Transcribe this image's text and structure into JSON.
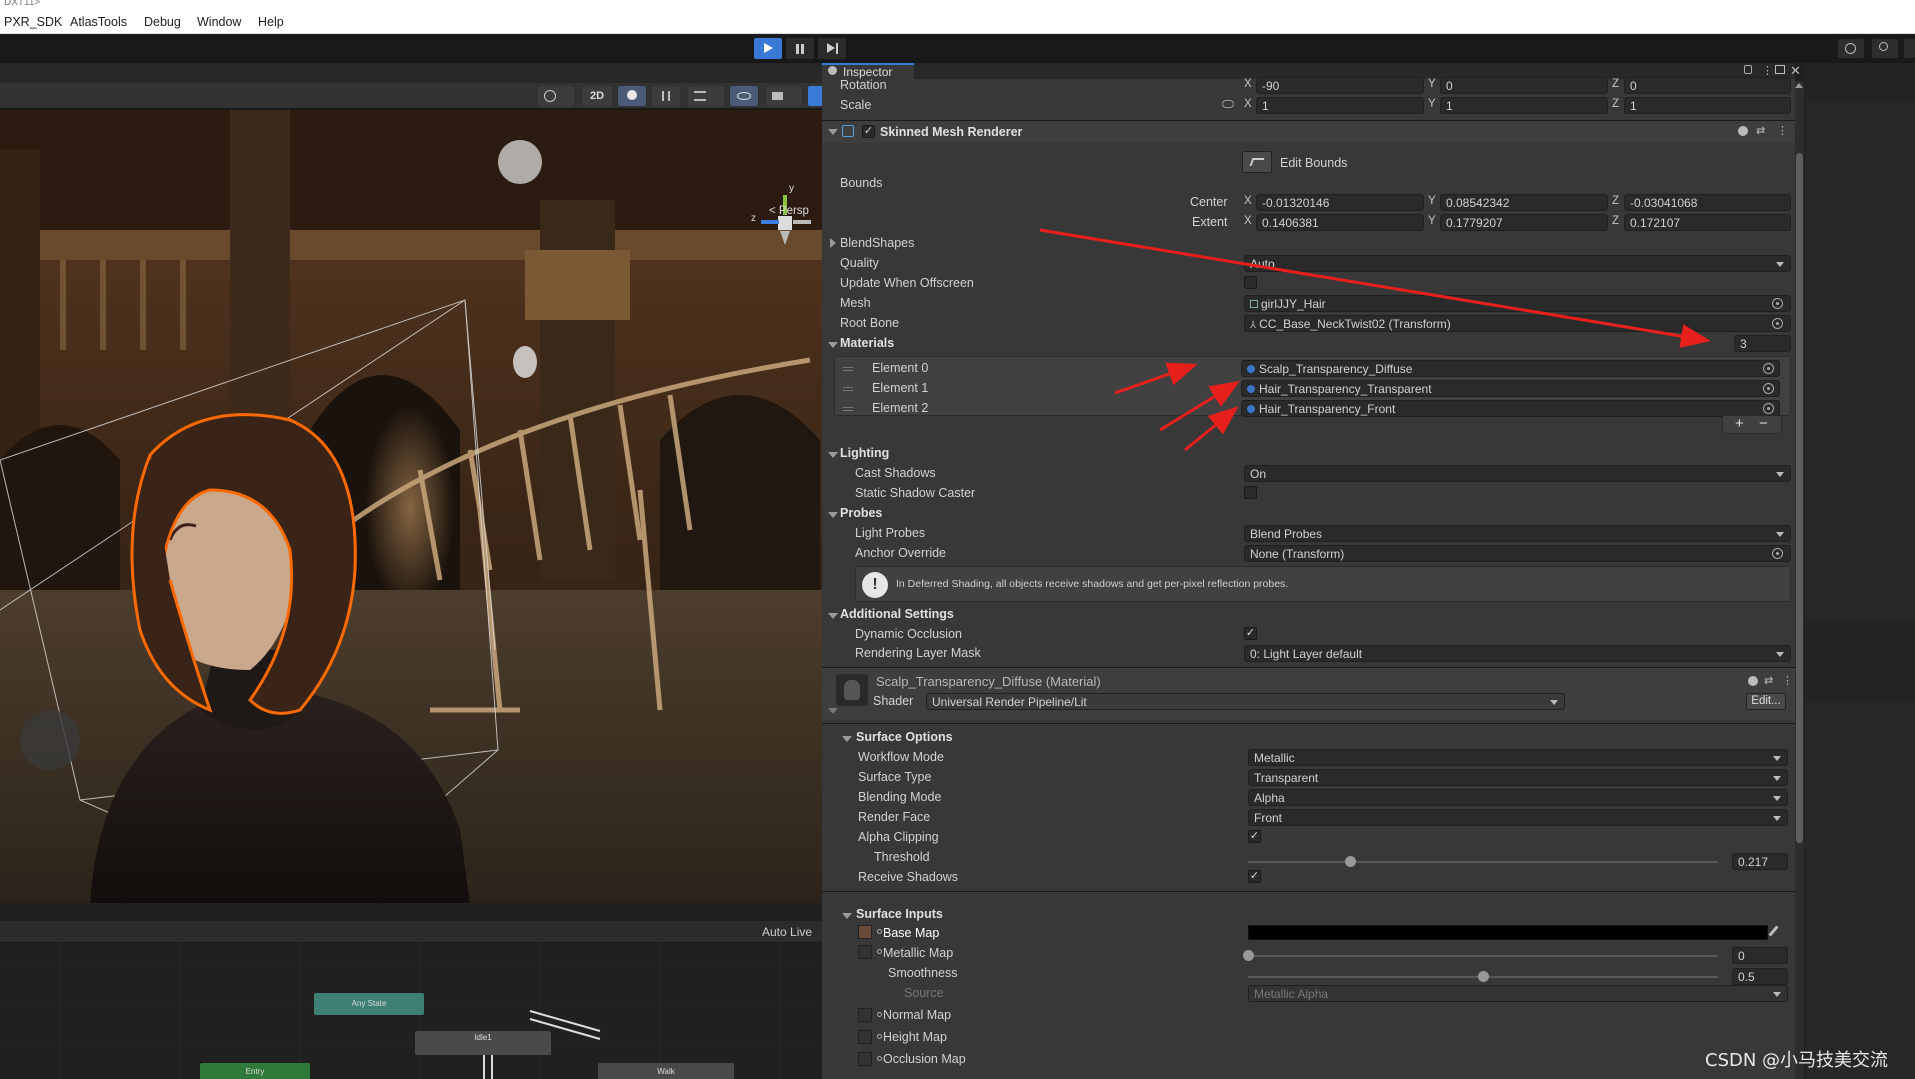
{
  "window": {
    "title": "DXT11>"
  },
  "menu": [
    "PXR_SDK",
    "AtlasTools",
    "Debug",
    "Window",
    "Help"
  ],
  "scene": {
    "toolbar": {
      "mode_2d": "2D"
    },
    "gizmo": {
      "persp": "< Persp",
      "y": "y",
      "z": "z"
    }
  },
  "animator": {
    "auto_live": "Auto Live",
    "nodes": {
      "any_state": "Any State",
      "idle": "Idle1",
      "entry": "Entry",
      "walk": "Walk"
    }
  },
  "inspector": {
    "tab": "Inspector",
    "transform": {
      "rotation": {
        "label": "Rotation",
        "x": "-90",
        "y": "0",
        "z": "0"
      },
      "scale": {
        "label": "Scale",
        "x": "1",
        "y": "1",
        "z": "1"
      }
    },
    "smr": {
      "title": "Skinned Mesh Renderer",
      "edit_bounds": "Edit Bounds",
      "bounds": "Bounds",
      "center": {
        "label": "Center",
        "x": "-0.01320146",
        "y": "0.08542342",
        "z": "-0.03041068"
      },
      "extent": {
        "label": "Extent",
        "x": "0.1406381",
        "y": "0.1779207",
        "z": "0.172107"
      },
      "blendshapes": "BlendShapes",
      "quality": {
        "label": "Quality",
        "value": "Auto"
      },
      "update_offscreen": "Update When Offscreen",
      "mesh": {
        "label": "Mesh",
        "value": "girlJJY_Hair"
      },
      "root_bone": {
        "label": "Root Bone",
        "value": "CC_Base_NeckTwist02 (Transform)"
      },
      "materials": {
        "label": "Materials",
        "count": "3",
        "elements": [
          {
            "label": "Element 0",
            "value": "Scalp_Transparency_Diffuse"
          },
          {
            "label": "Element 1",
            "value": "Hair_Transparency_Transparent"
          },
          {
            "label": "Element 2",
            "value": "Hair_Transparency_Front"
          }
        ],
        "add": "+",
        "remove": "−"
      },
      "lighting": {
        "label": "Lighting",
        "cast_shadows": {
          "label": "Cast Shadows",
          "value": "On"
        },
        "static_shadow": "Static Shadow Caster"
      },
      "probes": {
        "label": "Probes",
        "light_probes": {
          "label": "Light Probes",
          "value": "Blend Probes"
        },
        "anchor": {
          "label": "Anchor Override",
          "value": "None (Transform)"
        },
        "info": "In Deferred Shading, all objects receive shadows and get per-pixel reflection probes."
      },
      "additional": {
        "label": "Additional Settings",
        "dynamic_occlusion": "Dynamic Occlusion",
        "rendering_layer": {
          "label": "Rendering Layer Mask",
          "value": "0: Light Layer default"
        }
      }
    },
    "material": {
      "title": "Scalp_Transparency_Diffuse (Material)",
      "shader_label": "Shader",
      "shader": "Universal Render Pipeline/Lit",
      "edit": "Edit...",
      "surface_options": {
        "label": "Surface Options",
        "workflow": {
          "label": "Workflow Mode",
          "value": "Metallic"
        },
        "surface_type": {
          "label": "Surface Type",
          "value": "Transparent"
        },
        "blending": {
          "label": "Blending Mode",
          "value": "Alpha"
        },
        "render_face": {
          "label": "Render Face",
          "value": "Front"
        },
        "alpha_clipping": "Alpha Clipping",
        "threshold": {
          "label": "Threshold",
          "value": "0.217",
          "fraction": 0.217
        },
        "receive_shadows": "Receive Shadows"
      },
      "surface_inputs": {
        "label": "Surface Inputs",
        "base_map": "Base Map",
        "metallic_map": {
          "label": "Metallic Map",
          "value": "0",
          "fraction": 0
        },
        "smoothness": {
          "label": "Smoothness",
          "value": "0.5",
          "fraction": 0.5
        },
        "source": {
          "label": "Source",
          "value": "Metallic Alpha"
        },
        "normal_map": "Normal Map",
        "height_map": "Height Map",
        "occlusion_map": "Occlusion Map"
      }
    }
  },
  "watermark": "CSDN @小马技美交流",
  "colors": {
    "accent": "#3a79d6",
    "selection_outline": "#ff6a00",
    "annotation_arrow": "#e8201c",
    "panel": "#383838",
    "toolbar": "#282828"
  }
}
